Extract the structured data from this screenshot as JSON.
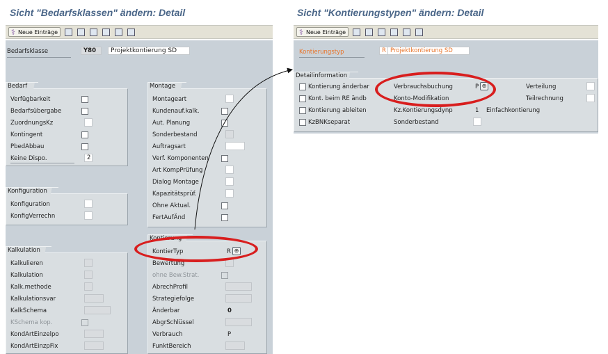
{
  "left": {
    "title": "Sicht \"Bedarfsklassen\" ändern: Detail",
    "toolbar": {
      "new_entries": "Neue Einträge"
    },
    "header": {
      "label": "Bedarfsklasse",
      "code": "Y80",
      "description": "Projektkontierung SD"
    },
    "bedarf": {
      "title": "Bedarf",
      "verfuegbarkeit": "Verfügbarkeit",
      "bedarfsuebergabe": "Bedarfsübergabe",
      "zuordnungskz": "ZuordnungsKz",
      "kontingent": "Kontingent",
      "pbedabbau": "PbedAbbau",
      "keine_dispo": "Keine Dispo.",
      "keine_dispo_value": "2"
    },
    "konfiguration": {
      "title": "Konfiguration",
      "konfiguration": "Konfiguration",
      "konfigverrechn": "KonfigVerrechn"
    },
    "kalkulation": {
      "title": "Kalkulation",
      "kalkulieren": "Kalkulieren",
      "kalkulation": "Kalkulation",
      "kalk_methode": "Kalk.methode",
      "kalkulationsvar": "Kalkulationsvar",
      "kalkschema": "KalkSchema",
      "kschema_kop": "KSchema kop.",
      "kondarteinzelpo": "KondArtEinzelpo",
      "kondarteinzpfix": "KondArtEinzpFix"
    },
    "montage": {
      "title": "Montage",
      "montageart": "Montageart",
      "kundenauf_kalk": "Kundenauf.kalk.",
      "aut_planung": "Aut. Planung",
      "sonderbestand": "Sonderbestand",
      "auftragsart": "Auftragsart",
      "verf_komponenten": "Verf. Komponenten",
      "art_komppruefung": "Art KompPrüfung",
      "dialog_montage": "Dialog Montage",
      "kapazitaetspruef": "Kapazitätsprüf.",
      "ohne_aktual": "Ohne Aktual.",
      "fertaufaend": "FertAufÄnd"
    },
    "kontierung": {
      "title": "Kontierung",
      "kontiertyp": "KontierTyp",
      "kontiertyp_value": "R",
      "bewertung": "Bewertung",
      "ohne_bew_strat": "ohne Bew.Strat.",
      "abrechprofil": "AbrechProfil",
      "strategiefolge": "Strategiefolge",
      "aenderbar": "Änderbar",
      "aenderbar_value": "0",
      "abgrschluessel": "AbgrSchlüssel",
      "verbrauch": "Verbrauch",
      "verbrauch_value": "P",
      "funktbereich": "FunktBereich"
    }
  },
  "right": {
    "title": "Sicht \"Kontierungstypen\" ändern: Detail",
    "toolbar": {
      "new_entries": "Neue Einträge"
    },
    "header": {
      "label": "Kontierungstyp",
      "code": "R",
      "description": "Projektkontierung SD"
    },
    "detail": {
      "title": "Detailinformation",
      "kontierung_aenderbar": "Kontierung änderbar",
      "kont_beim_re_aendb": "Kont. beim RE ändb",
      "kontierung_ableiten": "Kontierung ableiten",
      "kzbnkseparat": "KzBNKseparat",
      "verbrauchsbuchung": "Verbrauchsbuchung",
      "verbrauchsbuchung_value": "P",
      "konto_modifikation": "Konto-Modifikation",
      "kz_kontierungsdynp": "Kz.Kontierungsdynp",
      "kz_kontierungsdynp_value": "1",
      "einfachkontierung": "Einfachkontierung",
      "sonderbestand": "Sonderbestand",
      "verteilung": "Verteilung",
      "teilrechnung": "Teilrechnung"
    }
  },
  "colors": {
    "title": "#4a6688",
    "highlight": "#d81e1e",
    "panel": "#c9d1d8",
    "group": "#d9dee1",
    "orange_text": "#e8742a"
  }
}
